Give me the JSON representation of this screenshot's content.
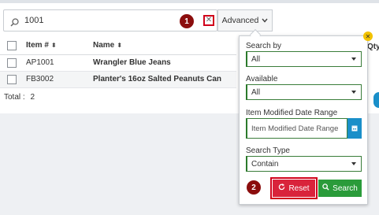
{
  "search": {
    "value": "1001",
    "advanced_label": "Advanced"
  },
  "markers": {
    "first": "1",
    "second": "2"
  },
  "table": {
    "headers": {
      "item": "Item #",
      "name": "Name",
      "qty": "Qty"
    },
    "rows": [
      {
        "item": "AP1001",
        "name": "Wrangler Blue Jeans"
      },
      {
        "item": "FB3002",
        "name": "Planter's 16oz Salted Peanuts Can"
      }
    ],
    "total_label": "Total :",
    "total_value": "2"
  },
  "advanced_panel": {
    "search_by_label": "Search by",
    "search_by_value": "All",
    "available_label": "Available",
    "available_value": "All",
    "date_range_label": "Item Modified Date Range",
    "date_range_placeholder": "Item Modified Date Range",
    "search_type_label": "Search Type",
    "search_type_value": "Contain",
    "reset_label": "Reset",
    "search_label": "Search"
  },
  "colors": {
    "marker": "#8b0d0d",
    "reset": "#d9233b",
    "search": "#2a9b3a",
    "calendar": "#1a8fc9"
  }
}
